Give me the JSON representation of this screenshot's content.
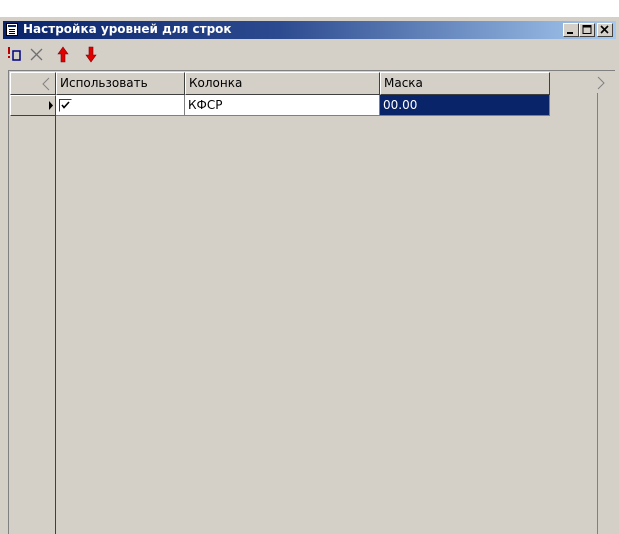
{
  "window": {
    "title": "Настройка уровней для строк",
    "controls": {
      "minimize": "minimize",
      "restore": "restore",
      "close": "close"
    }
  },
  "toolbar": {
    "items": [
      {
        "name": "add-level",
        "icon": "add-row-icon"
      },
      {
        "name": "delete-level",
        "icon": "delete-x-icon"
      },
      {
        "name": "move-up",
        "icon": "arrow-up-icon",
        "color": "#e00000"
      },
      {
        "name": "move-down",
        "icon": "arrow-down-icon",
        "color": "#e00000"
      }
    ]
  },
  "grid": {
    "columns": [
      "Использовать",
      "Колонка",
      "Маска"
    ],
    "rows": [
      {
        "use": true,
        "column": "КФСР",
        "mask": "00.00"
      }
    ],
    "selection_color": "#0a246a"
  }
}
